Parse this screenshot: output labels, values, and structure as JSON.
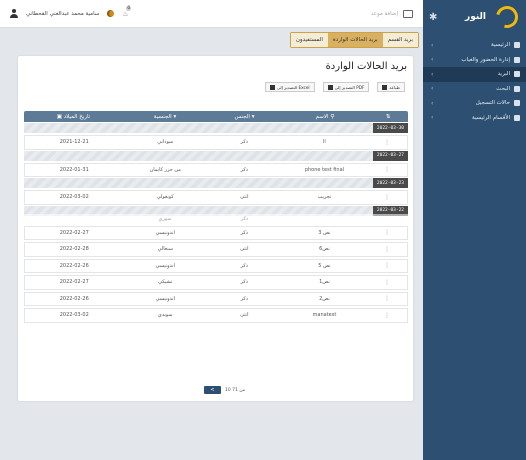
{
  "app": {
    "title": "النور"
  },
  "topbar": {
    "username": "سامية محمد عبدالغني القحطاني",
    "notif_count": "0",
    "right_label": "إضافة موعد"
  },
  "sidebar": {
    "items": [
      {
        "label": "الرئيسية",
        "has_children": true,
        "active": false
      },
      {
        "label": "إدارة الحضور والغياب",
        "has_children": true,
        "active": false
      },
      {
        "label": "البريد",
        "has_children": true,
        "active": true
      },
      {
        "label": "البحث",
        "has_children": true,
        "active": false
      },
      {
        "label": "حالات التسجيل",
        "has_children": true,
        "active": false
      },
      {
        "label": "الأقسام الرئيسية",
        "has_children": true,
        "active": false
      }
    ]
  },
  "tabs": {
    "beneficiaries": "المستفيدون",
    "inbox": "بريد الحالات الواردة",
    "dept_mail": "بريد القسم"
  },
  "page": {
    "title": "بريد الحالات الواردة"
  },
  "toolbar": {
    "print": "طباعة",
    "export_pdf": "التصدير إلى PDF",
    "export_excel": "التصدير إلى Excel"
  },
  "table": {
    "headers": {
      "name": "الاسم",
      "sex": "الجنس",
      "nationality": "الجنسية",
      "dob": "تاريخ الميلاد"
    },
    "groups": [
      {
        "date": "2022-03-30",
        "rows": [
          {
            "name": "ll",
            "sex": "ذكر",
            "nationality": "سوداني",
            "dob": "2021-12-21"
          }
        ]
      },
      {
        "date": "2022-03-27",
        "rows": [
          {
            "name": "phone test final",
            "sex": "ذكر",
            "nationality": "من جزر كايمان",
            "dob": "2022-01-31"
          }
        ]
      },
      {
        "date": "2022-03-23",
        "rows": [
          {
            "name": "تجريب",
            "sex": "أنثى",
            "nationality": "كونغولي",
            "dob": "2022-03-02"
          }
        ]
      },
      {
        "date": "2022-03-22",
        "rows": [
          {
            "name": "نص 3",
            "sex": "ذكر",
            "nationality": "اندونيسي",
            "dob": "2022-02-27"
          },
          {
            "name": "نص6",
            "sex": "أنثى",
            "nationality": "سنغالي",
            "dob": "2022-02-28"
          },
          {
            "name": "نص 5",
            "sex": "ذكر",
            "nationality": "اندونيسي",
            "dob": "2022-02-26"
          },
          {
            "name": "نص1",
            "sex": "ذكر",
            "nationality": "تشيكي",
            "dob": "2022-02-27"
          },
          {
            "name": "نص2",
            "sex": "ذكر",
            "nationality": "اندونيسي",
            "dob": "2022-02-26"
          },
          {
            "name": "manatest",
            "sex": "أنثى",
            "nationality": "سويدي",
            "dob": "2022-03-02"
          }
        ]
      }
    ],
    "faded_row": {
      "sex": "ذكر",
      "nationality": "سوري"
    }
  },
  "pagination": {
    "info": "10 من 71"
  },
  "colors": {
    "sidebar": "#2c4f72",
    "header": "#5d7a96",
    "accent": "#d8b060"
  }
}
